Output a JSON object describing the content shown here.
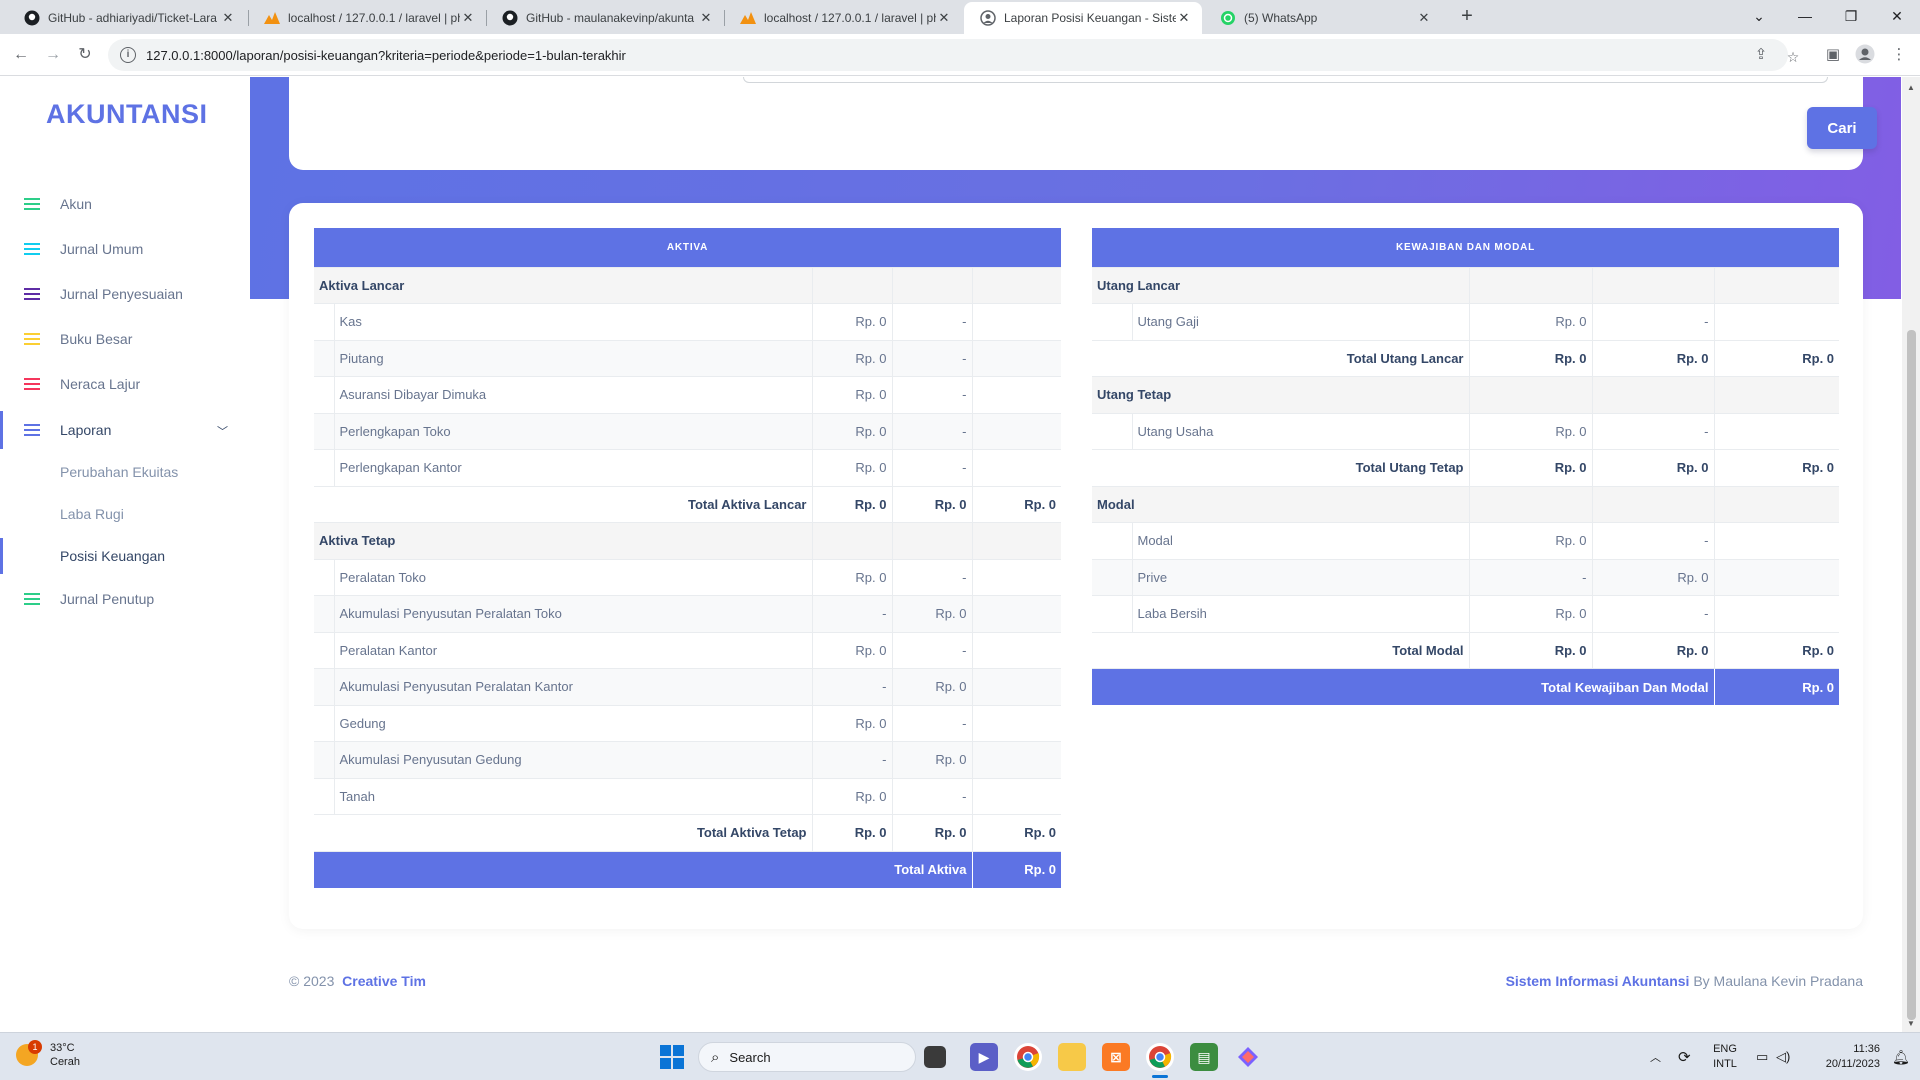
{
  "browser": {
    "tabs": [
      {
        "title": "GitHub - adhiariyadi/Ticket-Lara",
        "icon": "github-icon"
      },
      {
        "title": "localhost / 127.0.0.1 / laravel | ph",
        "icon": "phpmyadmin-icon"
      },
      {
        "title": "GitHub - maulanakevinp/akunta",
        "icon": "github-icon"
      },
      {
        "title": "localhost / 127.0.0.1 / laravel | ph",
        "icon": "phpmyadmin-icon"
      },
      {
        "title": "Laporan Posisi Keuangan - Siste",
        "icon": "app-favicon-icon"
      },
      {
        "title": "(5) WhatsApp",
        "icon": "whatsapp-icon"
      }
    ],
    "close_glyph": "✕",
    "new_tab_glyph": "+",
    "url": "127.0.0.1:8000/laporan/posisi-keuangan?kriteria=periode&periode=1-bulan-terakhir"
  },
  "sidebar": {
    "brand": "AKUNTANSI",
    "items": [
      {
        "label": "Akun",
        "color": "#2dce89"
      },
      {
        "label": "Jurnal Umum",
        "color": "#11cdef"
      },
      {
        "label": "Jurnal Penyesuaian",
        "color": "#5e2ca5"
      },
      {
        "label": "Buku Besar",
        "color": "#fbcf33"
      },
      {
        "label": "Neraca Lajur",
        "color": "#f5365c"
      },
      {
        "label": "Laporan",
        "color": "#5e72e4"
      },
      {
        "label": "Jurnal Penutup",
        "color": "#2dce89"
      }
    ],
    "sub_items": [
      {
        "label": "Perubahan Ekuitas"
      },
      {
        "label": "Laba Rugi"
      },
      {
        "label": "Posisi Keuangan"
      }
    ]
  },
  "search": {
    "button_label": "Cari"
  },
  "aktiva": {
    "header": "AKTIVA",
    "rows": [
      {
        "type": "sec",
        "label": "Aktiva Lancar"
      },
      {
        "type": "item",
        "label": "Kas",
        "c1": "Rp. 0",
        "c2": "-",
        "c3": ""
      },
      {
        "type": "item",
        "label": "Piutang",
        "c1": "Rp. 0",
        "c2": "-",
        "c3": ""
      },
      {
        "type": "item",
        "label": "Asuransi Dibayar Dimuka",
        "c1": "Rp. 0",
        "c2": "-",
        "c3": ""
      },
      {
        "type": "item",
        "label": "Perlengkapan Toko",
        "c1": "Rp. 0",
        "c2": "-",
        "c3": ""
      },
      {
        "type": "item",
        "label": "Perlengkapan Kantor",
        "c1": "Rp. 0",
        "c2": "-",
        "c3": ""
      },
      {
        "type": "tot",
        "label": "Total Aktiva Lancar",
        "c1": "Rp. 0",
        "c2": "Rp. 0",
        "c3": "Rp. 0"
      },
      {
        "type": "sec",
        "label": "Aktiva Tetap"
      },
      {
        "type": "item",
        "label": "Peralatan Toko",
        "c1": "Rp. 0",
        "c2": "-",
        "c3": ""
      },
      {
        "type": "item",
        "label": "Akumulasi Penyusutan Peralatan Toko",
        "c1": "-",
        "c2": "Rp. 0",
        "c3": ""
      },
      {
        "type": "item",
        "label": "Peralatan Kantor",
        "c1": "Rp. 0",
        "c2": "-",
        "c3": ""
      },
      {
        "type": "item",
        "label": "Akumulasi Penyusutan Peralatan Kantor",
        "c1": "-",
        "c2": "Rp. 0",
        "c3": ""
      },
      {
        "type": "item",
        "label": "Gedung",
        "c1": "Rp. 0",
        "c2": "-",
        "c3": ""
      },
      {
        "type": "item",
        "label": "Akumulasi Penyusutan Gedung",
        "c1": "-",
        "c2": "Rp. 0",
        "c3": ""
      },
      {
        "type": "item",
        "label": "Tanah",
        "c1": "Rp. 0",
        "c2": "-",
        "c3": ""
      },
      {
        "type": "tot",
        "label": "Total Aktiva Tetap",
        "c1": "Rp. 0",
        "c2": "Rp. 0",
        "c3": "Rp. 0"
      }
    ],
    "grand": {
      "label": "Total Aktiva",
      "value": "Rp. 0"
    }
  },
  "kewajiban": {
    "header": "KEWAJIBAN DAN MODAL",
    "rows": [
      {
        "type": "sec",
        "label": "Utang Lancar"
      },
      {
        "type": "item",
        "label": "Utang Gaji",
        "c1": "Rp. 0",
        "c2": "-",
        "c3": ""
      },
      {
        "type": "tot",
        "label": "Total Utang Lancar",
        "c1": "Rp. 0",
        "c2": "Rp. 0",
        "c3": "Rp. 0"
      },
      {
        "type": "sec",
        "label": "Utang Tetap"
      },
      {
        "type": "item",
        "label": "Utang Usaha",
        "c1": "Rp. 0",
        "c2": "-",
        "c3": ""
      },
      {
        "type": "tot",
        "label": "Total Utang Tetap",
        "c1": "Rp. 0",
        "c2": "Rp. 0",
        "c3": "Rp. 0"
      },
      {
        "type": "sec",
        "label": "Modal"
      },
      {
        "type": "item",
        "label": "Modal",
        "c1": "Rp. 0",
        "c2": "-",
        "c3": ""
      },
      {
        "type": "item",
        "label": "Prive",
        "c1": "-",
        "c2": "Rp. 0",
        "c3": ""
      },
      {
        "type": "item",
        "label": "Laba Bersih",
        "c1": "Rp. 0",
        "c2": "-",
        "c3": ""
      },
      {
        "type": "tot",
        "label": "Total Modal",
        "c1": "Rp. 0",
        "c2": "Rp. 0",
        "c3": "Rp. 0"
      }
    ],
    "grand": {
      "label": "Total Kewajiban Dan Modal",
      "value": "Rp. 0"
    }
  },
  "footer": {
    "copyright": "© 2023",
    "team": "Creative Tim",
    "app_name": "Sistem Informasi Akuntansi",
    "by": "By Maulana Kevin Pradana"
  },
  "taskbar": {
    "weather_temp": "33°C",
    "weather_desc": "Cerah",
    "weather_badge": "1",
    "search_placeholder": "Search",
    "lang_1": "ENG",
    "lang_2": "INTL",
    "time": "11:36",
    "date": "20/11/2023"
  }
}
